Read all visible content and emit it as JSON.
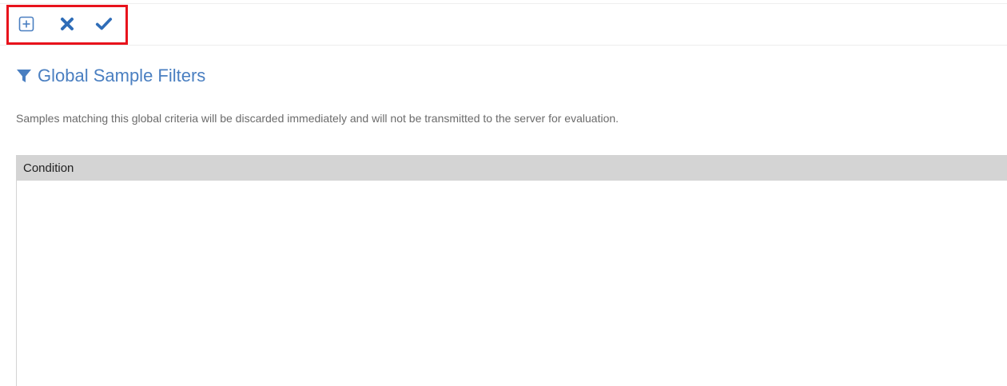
{
  "toolbar": {
    "buttons": [
      {
        "icon": "plus-square-icon",
        "color": "#4a7fc1"
      },
      {
        "icon": "close-icon",
        "color": "#2f6db8"
      },
      {
        "icon": "checkmark-icon",
        "color": "#2f6db8"
      }
    ],
    "highlight_color": "#e8131c"
  },
  "header": {
    "title": "Global Sample Filters",
    "icon": "filter-icon",
    "title_color": "#4a7fc1"
  },
  "description": "Samples matching this global criteria will be discarded immediately and will not be transmitted to the server for evaluation.",
  "table": {
    "columns": [
      "Condition"
    ],
    "rows": []
  }
}
